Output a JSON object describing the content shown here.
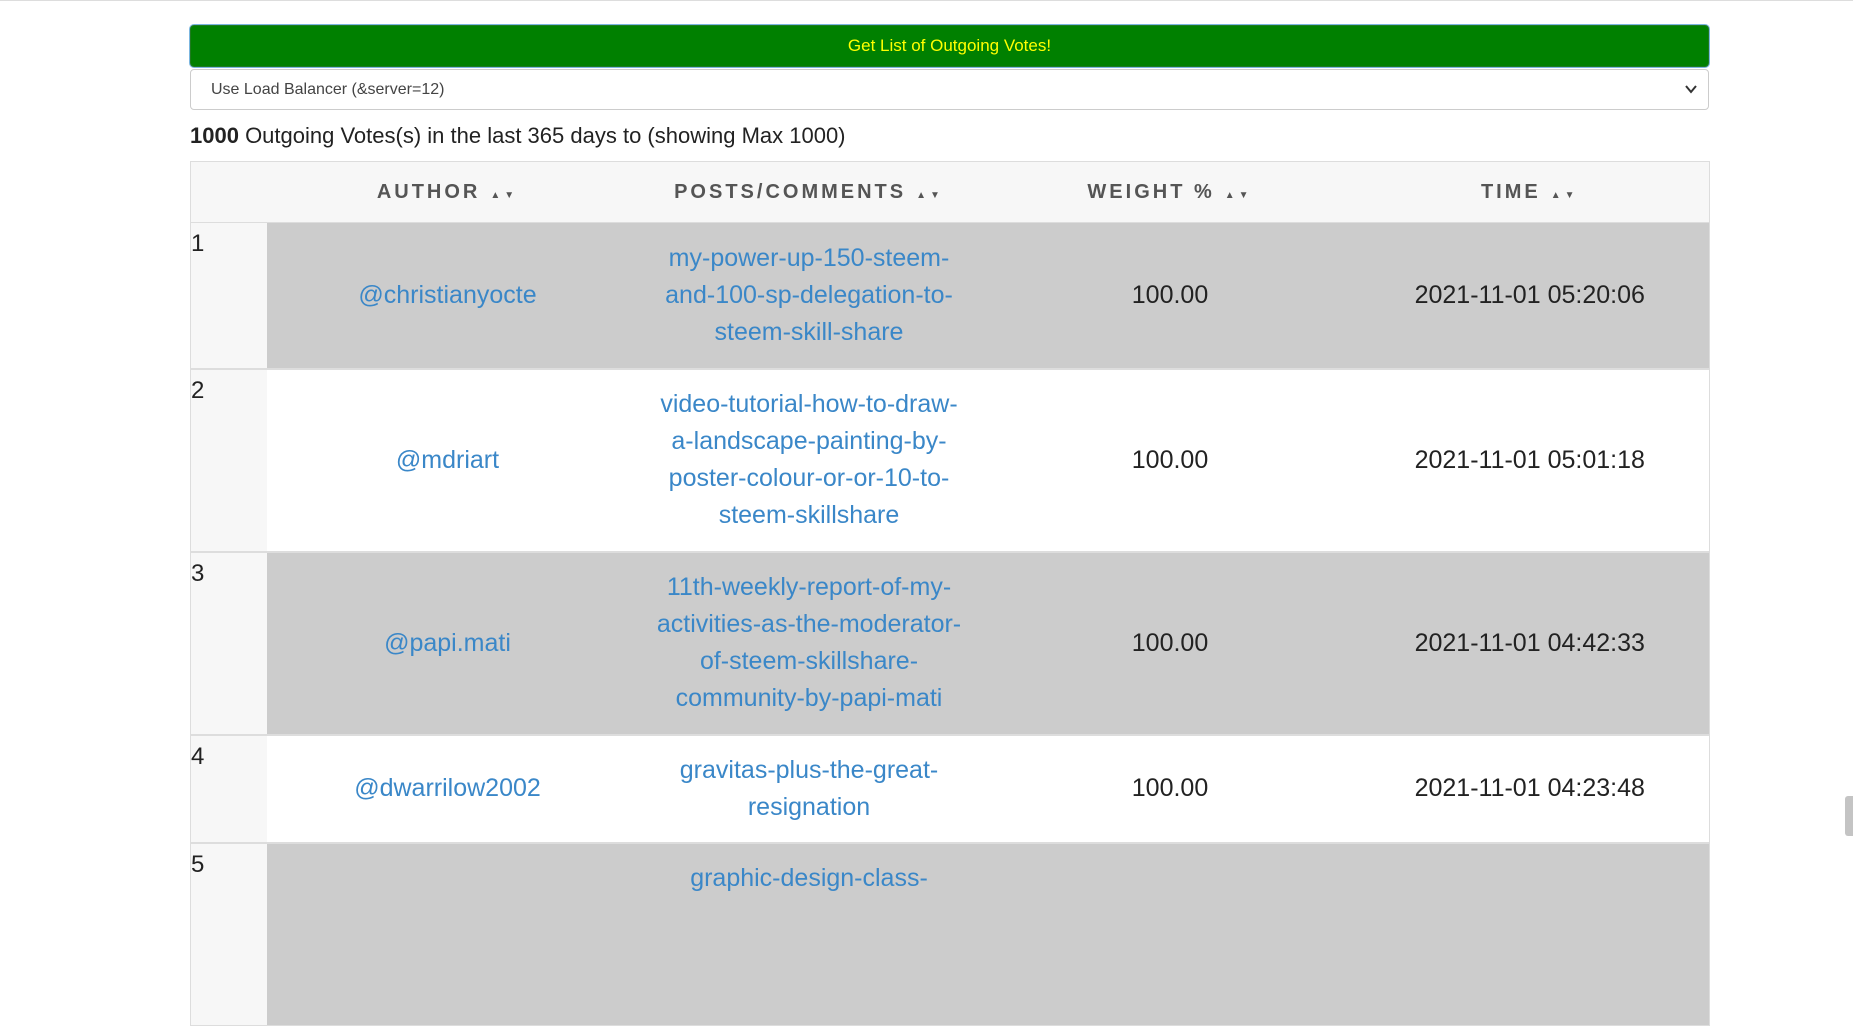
{
  "form": {
    "submit_label": "Get List of Outgoing Votes!",
    "server_select": {
      "selected": "Use Load Balancer (&server=12)"
    }
  },
  "summary": {
    "count": "1000",
    "text": " Outgoing Votes(s) in the last 365 days to (showing Max 1000)"
  },
  "table": {
    "headers": {
      "author": "AUTHOR",
      "posts": "POSTS/COMMENTS",
      "weight": "WEIGHT %",
      "time": "TIME"
    },
    "sort_glyph": "▲▼",
    "rows": [
      {
        "index": "1",
        "author": "@christianyocte",
        "post_lines": [
          "my-power-up-150-steem-",
          "and-100-sp-delegation-to-",
          "steem-skill-share"
        ],
        "weight": "100.00",
        "time": "2021-11-01 05:20:06"
      },
      {
        "index": "2",
        "author": "@mdriart",
        "post_lines": [
          "video-tutorial-how-to-draw-",
          "a-landscape-painting-by-",
          "poster-colour-or-or-10-to-",
          "steem-skillshare"
        ],
        "weight": "100.00",
        "time": "2021-11-01 05:01:18"
      },
      {
        "index": "3",
        "author": "@papi.mati",
        "post_lines": [
          "11th-weekly-report-of-my-",
          "activities-as-the-moderator-",
          "of-steem-skillshare-",
          "community-by-papi-mati"
        ],
        "weight": "100.00",
        "time": "2021-11-01 04:42:33"
      },
      {
        "index": "4",
        "author": "@dwarrilow2002",
        "post_lines": [
          "gravitas-plus-the-great-",
          "resignation"
        ],
        "weight": "100.00",
        "time": "2021-11-01 04:23:48"
      },
      {
        "index": "5",
        "author": "",
        "post_lines": [
          "graphic-design-class-"
        ],
        "weight": "",
        "time": ""
      }
    ]
  },
  "colors": {
    "button_bg": "#008000",
    "button_text": "#ffff00",
    "link": "#3a87c8",
    "row_shade": "#cccccc"
  }
}
